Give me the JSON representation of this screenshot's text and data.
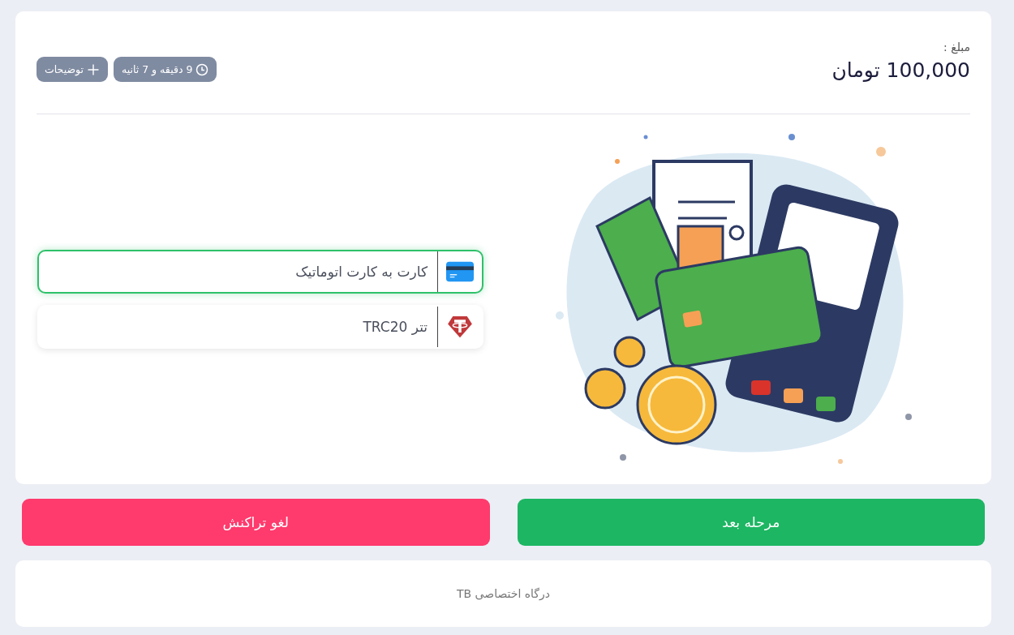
{
  "amount": {
    "label": "مبلغ :",
    "value": "100,000 تومان"
  },
  "badges": [
    {
      "kind": "timer",
      "text": "9 دقیقه و 7 ثانیه"
    },
    {
      "kind": "notes",
      "text": "توضیحات"
    }
  ],
  "methods": [
    {
      "kind": "card",
      "label": "کارت به کارت اتوماتیک",
      "selected": true
    },
    {
      "kind": "tether",
      "label": "تتر TRC20",
      "selected": false
    }
  ],
  "buttons": [
    {
      "kind": "next",
      "label": "مرحله بعد"
    },
    {
      "kind": "cancel",
      "label": "لغو تراکنش"
    }
  ],
  "footer": "درگاه اختصاصی TB"
}
